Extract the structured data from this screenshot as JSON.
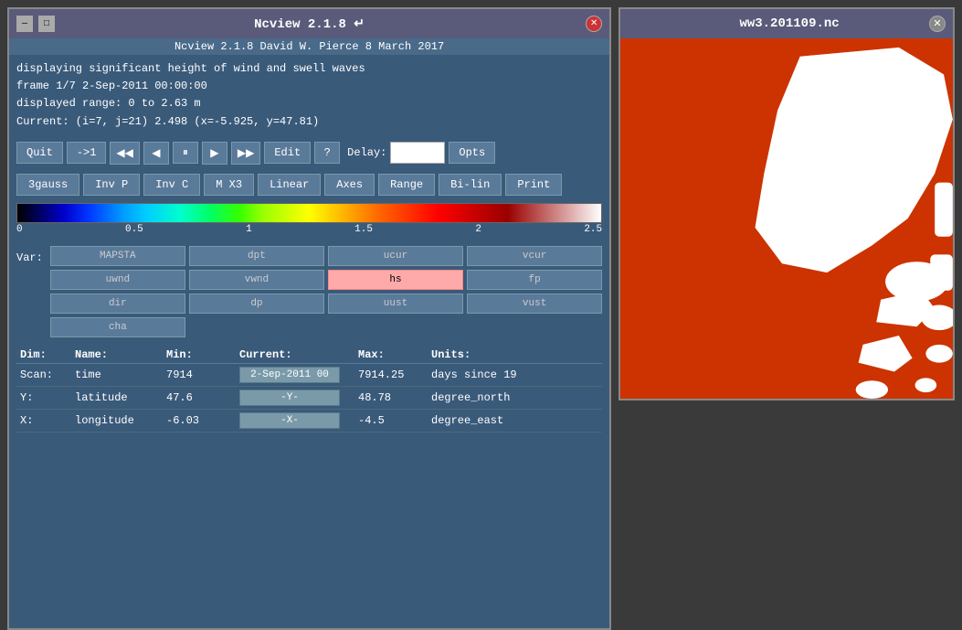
{
  "ncview_window": {
    "title": "Ncview 2.1.8 ↵",
    "title_btn_minimize": "—",
    "title_btn_maximize": "□",
    "title_btn_close": "✕",
    "info_bar": "Ncview 2.1.8  David W. Pierce   8 March 2017",
    "info_lines": [
      "displaying significant height of wind and swell waves",
      "frame 1/7  2-Sep-2011 00:00:00",
      "displayed range: 0 to 2.63 m",
      "Current: (i=7, j=21) 2.498  (x=-5.925, y=47.81)"
    ],
    "controls": {
      "quit": "Quit",
      "step1": "->1",
      "rewind": "◀◀",
      "prev": "◀",
      "pause": "⏸",
      "next": "▶",
      "forward": "▶▶",
      "edit": "Edit",
      "help": "?",
      "delay_label": "Delay:",
      "delay_value": "",
      "opts": "Opts"
    },
    "functions": {
      "gauss": "3gauss",
      "inv_p": "Inv P",
      "inv_c": "Inv C",
      "m_x3": "M X3",
      "linear": "Linear",
      "axes": "Axes",
      "range": "Range",
      "bi_lin": "Bi-lin",
      "print": "Print"
    },
    "colorbar": {
      "labels": [
        "0",
        "0.5",
        "1",
        "1.5",
        "2",
        "2.5"
      ]
    },
    "var_section": {
      "label": "Var:",
      "variables": [
        {
          "name": "MAPSTA",
          "active": false
        },
        {
          "name": "dpt",
          "active": false
        },
        {
          "name": "ucur",
          "active": false
        },
        {
          "name": "vcur",
          "active": false
        },
        {
          "name": "uwnd",
          "active": false
        },
        {
          "name": "vwnd",
          "active": false
        },
        {
          "name": "hs",
          "active": true
        },
        {
          "name": "fp",
          "active": false
        },
        {
          "name": "dir",
          "active": false
        },
        {
          "name": "dp",
          "active": false
        },
        {
          "name": "uust",
          "active": false
        },
        {
          "name": "vust",
          "active": false
        },
        {
          "name": "cha",
          "active": false
        }
      ]
    },
    "dim_section": {
      "headers": [
        "Dim:",
        "Name:",
        "Min:",
        "Current:",
        "Max:",
        "Units:"
      ],
      "rows": [
        {
          "dim": "Scan:",
          "name": "time",
          "min": "7914",
          "current": "2-Sep-2011 00",
          "max": "7914.25",
          "units": "days since 19"
        },
        {
          "dim": "Y:",
          "name": "latitude",
          "min": "47.6",
          "current": "-Y-",
          "max": "48.78",
          "units": "degree_north"
        },
        {
          "dim": "X:",
          "name": "longitude",
          "min": "-6.03",
          "current": "-X-",
          "max": "-4.5",
          "units": "degree_east"
        }
      ]
    }
  },
  "ww3_window": {
    "title": "ww3.201109.nc",
    "close_btn": "✕"
  }
}
